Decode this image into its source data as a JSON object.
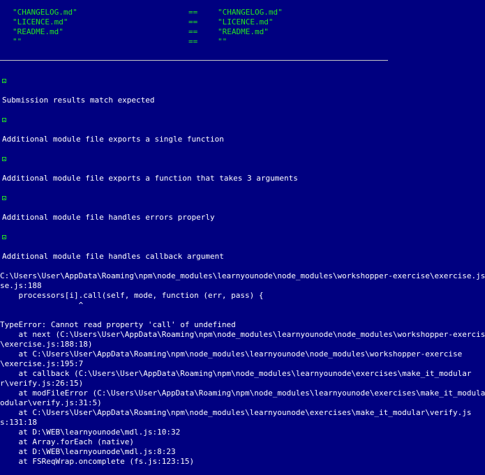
{
  "comparison_rows": [
    {
      "left": "\"CHANGELOG.md\"",
      "op": "==",
      "right": "\"CHANGELOG.md\""
    },
    {
      "left": "\"LICENCE.md\"",
      "op": "==",
      "right": "\"LICENCE.md\""
    },
    {
      "left": "\"README.md\"",
      "op": "==",
      "right": "\"README.md\""
    },
    {
      "left": "\"\"",
      "op": "==",
      "right": "\"\""
    }
  ],
  "results": [
    "Submission results match expected",
    "Additional module file exports a single function",
    "Additional module file exports a function that takes 3 arguments",
    "Additional module file handles errors properly",
    "Additional module file handles callback argument"
  ],
  "result_icon": "check-icon",
  "error_output": [
    "C:\\Users\\User\\AppData\\Roaming\\npm\\node_modules\\learnyounode\\node_modules\\workshopper-exercise\\exercise.js:188",
    "se.js:188",
    "    processors[i].call(self, mode, function (err, pass) {",
    "                 ^",
    "",
    "TypeError: Cannot read property 'call' of undefined",
    "    at next (C:\\Users\\User\\AppData\\Roaming\\npm\\node_modules\\learnyounode\\node_modules\\workshopper-exercise",
    "\\exercise.js:188:18)",
    "    at C:\\Users\\User\\AppData\\Roaming\\npm\\node_modules\\learnyounode\\node_modules\\workshopper-exercise",
    "\\exercise.js:195:7",
    "    at callback (C:\\Users\\User\\AppData\\Roaming\\npm\\node_modules\\learnyounode\\exercises\\make_it_modular",
    "r\\verify.js:26:15)",
    "    at modFileError (C:\\Users\\User\\AppData\\Roaming\\npm\\node_modules\\learnyounode\\exercises\\make_it_modular",
    "odular\\verify.js:31:5)",
    "    at C:\\Users\\User\\AppData\\Roaming\\npm\\node_modules\\learnyounode\\exercises\\make_it_modular\\verify.js",
    "s:131:18",
    "    at D:\\WEB\\learnyounode\\mdl.js:10:32",
    "    at Array.forEach (native)",
    "    at D:\\WEB\\learnyounode\\mdl.js:8:23",
    "    at FSReqWrap.oncomplete (fs.js:123:15)"
  ],
  "colors": {
    "background": "#000080",
    "green": "#23e323",
    "text": "#ffffff",
    "separator": "#c8c8c8"
  }
}
